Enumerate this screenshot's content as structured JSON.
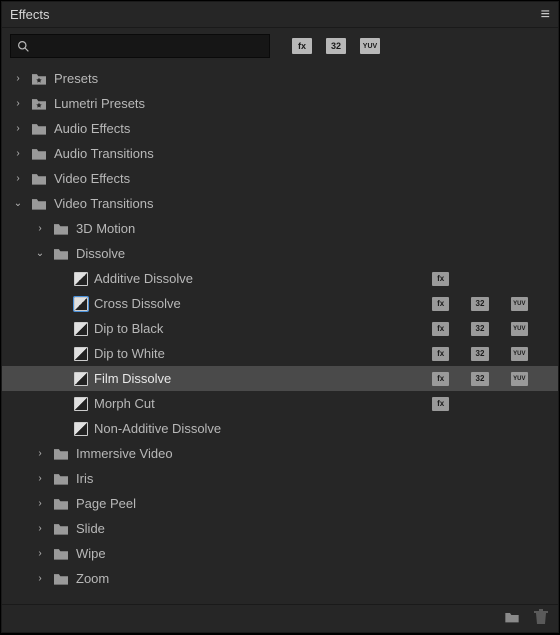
{
  "panel": {
    "title": "Effects"
  },
  "search": {
    "placeholder": ""
  },
  "toolbar_badges": [
    "fx",
    "32",
    "YUV"
  ],
  "footer": {
    "new_folder": "new-folder-icon",
    "trash": "trash-icon"
  },
  "tree": [
    {
      "kind": "folder",
      "label": "Presets",
      "depth": 0,
      "expanded": false,
      "star": true
    },
    {
      "kind": "folder",
      "label": "Lumetri Presets",
      "depth": 0,
      "expanded": false,
      "star": true
    },
    {
      "kind": "folder",
      "label": "Audio Effects",
      "depth": 0,
      "expanded": false
    },
    {
      "kind": "folder",
      "label": "Audio Transitions",
      "depth": 0,
      "expanded": false
    },
    {
      "kind": "folder",
      "label": "Video Effects",
      "depth": 0,
      "expanded": false
    },
    {
      "kind": "folder",
      "label": "Video Transitions",
      "depth": 0,
      "expanded": true
    },
    {
      "kind": "folder",
      "label": "3D Motion",
      "depth": 1,
      "expanded": false
    },
    {
      "kind": "folder",
      "label": "Dissolve",
      "depth": 1,
      "expanded": true
    },
    {
      "kind": "effect",
      "label": "Additive Dissolve",
      "depth": 2,
      "badges": [
        true,
        false,
        false
      ]
    },
    {
      "kind": "effect",
      "label": "Cross Dissolve",
      "depth": 2,
      "badges": [
        true,
        true,
        true
      ],
      "outlined": true
    },
    {
      "kind": "effect",
      "label": "Dip to Black",
      "depth": 2,
      "badges": [
        true,
        true,
        true
      ]
    },
    {
      "kind": "effect",
      "label": "Dip to White",
      "depth": 2,
      "badges": [
        true,
        true,
        true
      ]
    },
    {
      "kind": "effect",
      "label": "Film Dissolve",
      "depth": 2,
      "badges": [
        true,
        true,
        true
      ],
      "selected": true
    },
    {
      "kind": "effect",
      "label": "Morph Cut",
      "depth": 2,
      "badges": [
        true,
        false,
        false
      ]
    },
    {
      "kind": "effect",
      "label": "Non-Additive Dissolve",
      "depth": 2,
      "badges": [
        false,
        false,
        false
      ]
    },
    {
      "kind": "folder",
      "label": "Immersive Video",
      "depth": 1,
      "expanded": false
    },
    {
      "kind": "folder",
      "label": "Iris",
      "depth": 1,
      "expanded": false
    },
    {
      "kind": "folder",
      "label": "Page Peel",
      "depth": 1,
      "expanded": false
    },
    {
      "kind": "folder",
      "label": "Slide",
      "depth": 1,
      "expanded": false
    },
    {
      "kind": "folder",
      "label": "Wipe",
      "depth": 1,
      "expanded": false
    },
    {
      "kind": "folder",
      "label": "Zoom",
      "depth": 1,
      "expanded": false
    }
  ],
  "badge_labels": [
    "fx",
    "32",
    "YUV"
  ]
}
